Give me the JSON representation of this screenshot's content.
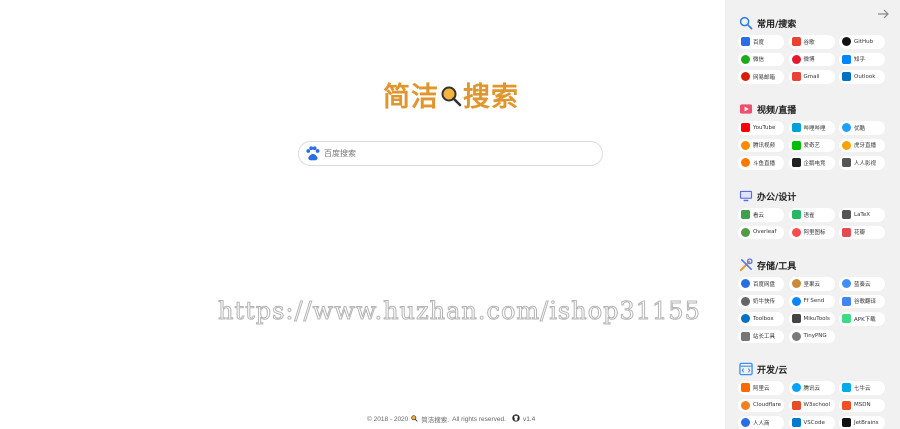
{
  "logo": {
    "part1": "简洁",
    "part2": "搜索"
  },
  "search": {
    "placeholder": "百度搜索"
  },
  "watermark": "https://www.huzhan.com/ishop31155",
  "footer": {
    "copyright": "© 2018 - 2020",
    "brand": "简洁搜索.",
    "rights": "All rights reserved.",
    "version": "v1.4"
  },
  "sidebar": {
    "sections": [
      {
        "title": "常用/搜索",
        "icon": "search-icon",
        "items": [
          {
            "label": "百度",
            "icon": "baidu-icon",
            "color": "#2b6de5"
          },
          {
            "label": "谷歌",
            "icon": "google-icon",
            "color": "#ea4335"
          },
          {
            "label": "GitHub",
            "icon": "github-icon",
            "color": "#111111"
          },
          {
            "label": "微信",
            "icon": "wechat-icon",
            "color": "#1aad19"
          },
          {
            "label": "微博",
            "icon": "weibo-icon",
            "color": "#e6162d"
          },
          {
            "label": "知乎",
            "icon": "zhihu-icon",
            "color": "#0084ff"
          },
          {
            "label": "网易邮箱",
            "icon": "netease-mail-icon",
            "color": "#d81e06"
          },
          {
            "label": "Gmail",
            "icon": "gmail-icon",
            "color": "#ea4335"
          },
          {
            "label": "Outlook",
            "icon": "outlook-icon",
            "color": "#0072c6"
          }
        ]
      },
      {
        "title": "视频/直播",
        "icon": "video-icon",
        "items": [
          {
            "label": "YouTube",
            "icon": "youtube-icon",
            "color": "#ff0000"
          },
          {
            "label": "哔哩哔哩",
            "icon": "bilibili-icon",
            "color": "#00a1d6"
          },
          {
            "label": "优酷",
            "icon": "youku-icon",
            "color": "#1ea0f8"
          },
          {
            "label": "腾讯视频",
            "icon": "tencent-video-icon",
            "color": "#ff8a00"
          },
          {
            "label": "爱奇艺",
            "icon": "iqiyi-icon",
            "color": "#00be06"
          },
          {
            "label": "虎牙直播",
            "icon": "huya-icon",
            "color": "#ffa200"
          },
          {
            "label": "斗鱼直播",
            "icon": "douyu-icon",
            "color": "#ff7700"
          },
          {
            "label": "企鹅电竞",
            "icon": "egame-icon",
            "color": "#222222"
          },
          {
            "label": "人人影视",
            "icon": "rrys-icon",
            "color": "#555555"
          }
        ]
      },
      {
        "title": "办公/设计",
        "icon": "monitor-icon",
        "items": [
          {
            "label": "看云",
            "icon": "kancloud-icon",
            "color": "#3aa14c"
          },
          {
            "label": "语雀",
            "icon": "yuque-icon",
            "color": "#25b864"
          },
          {
            "label": "LaTeX",
            "icon": "latex-icon",
            "color": "#555555"
          },
          {
            "label": "Overleaf",
            "icon": "overleaf-icon",
            "color": "#4f9c45"
          },
          {
            "label": "阿里图标",
            "icon": "iconfont-icon",
            "color": "#f94d4d"
          },
          {
            "label": "花瓣",
            "icon": "huaban-icon",
            "color": "#e24c4c"
          }
        ]
      },
      {
        "title": "存储/工具",
        "icon": "tools-icon",
        "items": [
          {
            "label": "百度网盘",
            "icon": "baidu-pan-icon",
            "color": "#2b6de5"
          },
          {
            "label": "坚果云",
            "icon": "jianguoyun-icon",
            "color": "#c98a3a"
          },
          {
            "label": "蓝奏云",
            "icon": "lanzou-icon",
            "color": "#3e8ef7"
          },
          {
            "label": "奶牛快传",
            "icon": "cowtransfer-icon",
            "color": "#666666"
          },
          {
            "label": "Ff Send",
            "icon": "firefox-send-icon",
            "color": "#0a84ff"
          },
          {
            "label": "谷歌翻译",
            "icon": "google-translate-icon",
            "color": "#4285f4"
          },
          {
            "label": "Toolbox",
            "icon": "toolbox-icon",
            "color": "#0072c6"
          },
          {
            "label": "MikuTools",
            "icon": "mikutools-icon",
            "color": "#444444"
          },
          {
            "label": "APK下载",
            "icon": "apk-icon",
            "color": "#3ddc84"
          },
          {
            "label": "站长工具",
            "icon": "chinaz-icon",
            "color": "#777777"
          },
          {
            "label": "TinyPNG",
            "icon": "tinypng-icon",
            "color": "#7a7a7a"
          }
        ]
      },
      {
        "title": "开发/云",
        "icon": "code-icon",
        "items": [
          {
            "label": "阿里云",
            "icon": "aliyun-icon",
            "color": "#ff6a00"
          },
          {
            "label": "腾讯云",
            "icon": "tencent-cloud-icon",
            "color": "#00a3ff"
          },
          {
            "label": "七牛云",
            "icon": "qiniu-icon",
            "color": "#00aaeb"
          },
          {
            "label": "Cloudflare",
            "icon": "cloudflare-icon",
            "color": "#f38020"
          },
          {
            "label": "W3school",
            "icon": "w3school-icon",
            "color": "#e44d26"
          },
          {
            "label": "MSDN",
            "icon": "msdn-icon",
            "color": "#f25022"
          },
          {
            "label": "人人商",
            "icon": "renren-icon",
            "color": "#2b6de5"
          },
          {
            "label": "VSCode",
            "icon": "vscode-icon",
            "color": "#007acc"
          },
          {
            "label": "JetBrains",
            "icon": "jetbrains-icon",
            "color": "#111111"
          }
        ]
      }
    ]
  }
}
